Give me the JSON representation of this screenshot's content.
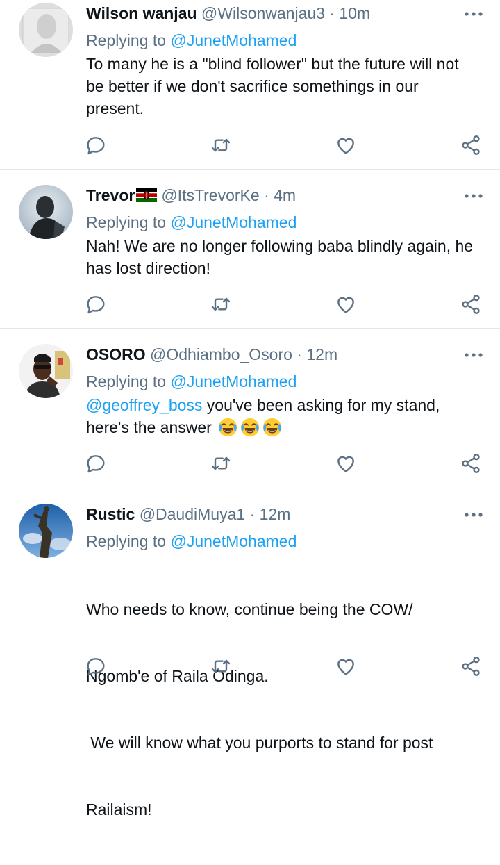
{
  "colors": {
    "link": "#1da1f2",
    "muted": "#5b7083",
    "text": "#0f1419",
    "divider": "#e1e8ed"
  },
  "tweets": [
    {
      "name": "Wilson wanjau",
      "handle": "@Wilsonwanjau3",
      "separator": "·",
      "time": "10m",
      "reply_prefix": "Replying to",
      "reply_to": "@JunetMohamed",
      "text_lines": [
        "To many he is a \"blind follower\" but the future will not",
        "be better if we don't sacrifice somethings in our",
        "present."
      ],
      "avatar": "avatar-grey-portrait"
    },
    {
      "name": "Trevor",
      "flag": "kenya-flag-icon",
      "handle": "@ItsTrevorKe",
      "separator": "·",
      "time": "4m",
      "reply_prefix": "Replying to",
      "reply_to": "@JunetMohamed",
      "text_lines": [
        "Nah! We are no longer following baba blindly again, he",
        "has lost direction!"
      ],
      "avatar": "avatar-sculpture"
    },
    {
      "name": "OSORO",
      "handle": "@Odhiambo_Osoro",
      "separator": "·",
      "time": "12m",
      "reply_prefix": "Replying to",
      "reply_to": "@JunetMohamed",
      "text_mention": "@geoffrey_boss",
      "text_line1_rest": " you've been asking for my stand,",
      "text_line2": "here's the answer ",
      "emoji": "tears-of-joy-emoji",
      "avatar": "avatar-man-glasses"
    },
    {
      "name": "Rustic",
      "handle": "@DaudiMuya1",
      "separator": "·",
      "time": "12m",
      "reply_prefix": "Replying to",
      "reply_to": "@JunetMohamed",
      "text_lines": [
        "Who needs to know, continue being the COW/",
        "Ngomb'e of Raila Odinga.",
        " We will know what you purports to stand for post",
        "Railaism!"
      ],
      "avatar": "avatar-statue-sky"
    }
  ]
}
